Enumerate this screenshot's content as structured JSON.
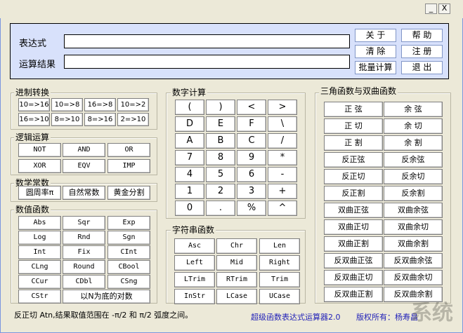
{
  "window": {
    "title": "",
    "minimize": "_",
    "close": "X"
  },
  "top": {
    "expr_label": "表达式",
    "result_label": "运算结果",
    "expr_value": "",
    "result_value": "",
    "buttons": [
      "关 于",
      "帮 助",
      "清 除",
      "注 册",
      "批量计算",
      "退 出"
    ]
  },
  "jinzhi": {
    "title": "进制转换",
    "buttons": [
      "10=>16",
      "10=>8",
      "16=>8",
      "10=>2",
      "16=>10",
      "8=>10",
      "8=>16",
      "2=>10"
    ]
  },
  "luoji": {
    "title": "逻辑运算",
    "buttons": [
      "NOT",
      "AND",
      "OR",
      "XOR",
      "EQV",
      "IMP"
    ]
  },
  "changshu": {
    "title": "数学常数",
    "buttons": [
      "圆周率π",
      "自然常数",
      "黄金分割"
    ]
  },
  "shuzhi": {
    "title": "数值函数",
    "buttons": [
      "Abs",
      "Sqr",
      "Exp",
      "Log",
      "Rnd",
      "Sgn",
      "Int",
      "Fix",
      "CInt",
      "CLng",
      "Round",
      "CBool",
      "CCur",
      "CDbl",
      "CSng",
      "CStr",
      "以N为底的对数"
    ]
  },
  "shuzi": {
    "title": "数字计算",
    "buttons": [
      "(",
      ")",
      "<",
      ">",
      "D",
      "E",
      "F",
      "\\",
      "A",
      "B",
      "C",
      "/",
      "7",
      "8",
      "9",
      "*",
      "4",
      "5",
      "6",
      "-",
      "1",
      "2",
      "3",
      "+",
      "0",
      ".",
      "%",
      "^"
    ]
  },
  "zifu": {
    "title": "字符串函数",
    "buttons": [
      "Asc",
      "Chr",
      "Len",
      "Left",
      "Mid",
      "Right",
      "LTrim",
      "RTrim",
      "Trim",
      "InStr",
      "LCase",
      "UCase"
    ]
  },
  "sanjiao": {
    "title": "三角函数与双曲函数",
    "buttons": [
      "正 弦",
      "余 弦",
      "正 切",
      "余 切",
      "正 割",
      "余 割",
      "反正弦",
      "反余弦",
      "反正切",
      "反余切",
      "反正割",
      "反余割",
      "双曲正弦",
      "双曲余弦",
      "双曲正切",
      "双曲余切",
      "双曲正割",
      "双曲余割",
      "反双曲正弦",
      "反双曲余弦",
      "反双曲正切",
      "反双曲余切",
      "反双曲正割",
      "反双曲余割"
    ]
  },
  "status": {
    "hint": "反正切 Atn,结果取值范围在 -π/2 和 π/2 弧度之间。",
    "app_name": "超级函数表达式运算器2.0",
    "copyright": "版权所有：杨寿昌"
  },
  "colors": {
    "topbox_bg": "#d8e1fb",
    "status_blue": "#1f1fb8",
    "title_blue": "#0b2a8f"
  }
}
